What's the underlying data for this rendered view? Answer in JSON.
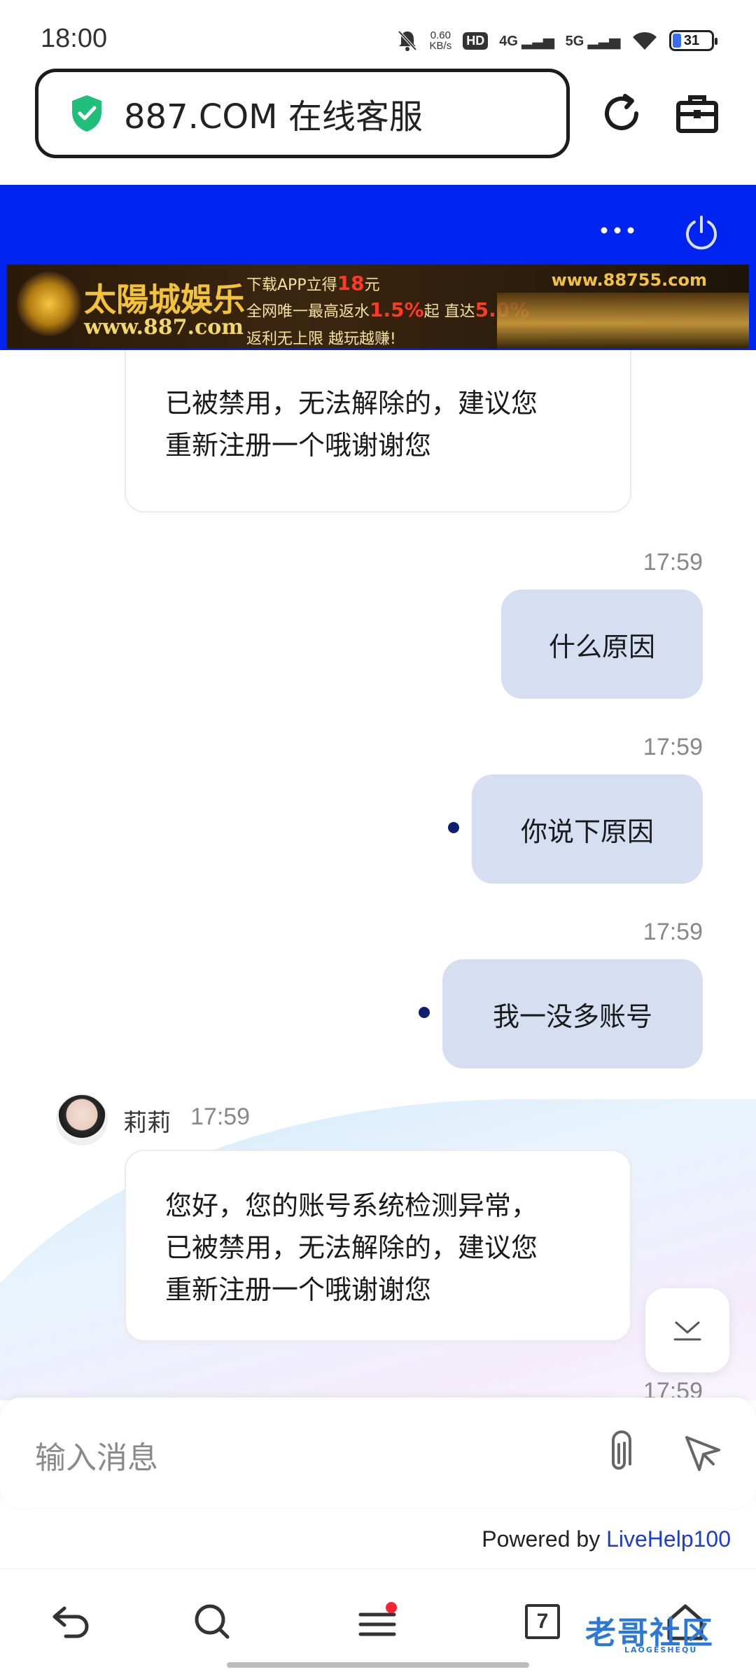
{
  "status_bar": {
    "time": "18:00",
    "net_speed": "0.60",
    "net_unit": "KB/s",
    "hd": "HD",
    "sim1": "4G",
    "sim2": "5G",
    "battery": "31"
  },
  "browser": {
    "address": "887.COM 在线客服",
    "refresh_icon": "refresh-icon",
    "toolbox_icon": "toolbox-icon",
    "shield_color": "#1fbf7a"
  },
  "header": {
    "more_icon": "more-icon",
    "power_icon": "power-icon",
    "accent_color": "#0024f0"
  },
  "banner": {
    "logo": "太陽城娛乐",
    "url_left": "www.887.com",
    "line1_prefix": "下载APP立得",
    "line1_highlight": "18",
    "line1_suffix": "元",
    "line2_prefix": "全网唯一最高返水",
    "line2_highlight1": "1.5%",
    "line2_mid": "起 直达",
    "line2_highlight2": "5.0%",
    "line3": "返利无上限 越玩越赚!",
    "url_right": "www.88755.com"
  },
  "messages": [
    {
      "from": "agent",
      "text_line1": "已被禁用，无法解除的，建议您",
      "text_line2": "重新注册一个哦谢谢您"
    },
    {
      "from": "user",
      "time": "17:59",
      "text": "什么原因"
    },
    {
      "from": "user",
      "time": "17:59",
      "text": "你说下原因"
    },
    {
      "from": "user",
      "time": "17:59",
      "text": "我一没多账号"
    },
    {
      "from": "agent",
      "name": "莉莉",
      "time": "17:59",
      "line1": "您好，您的账号系统检测异常，",
      "line2": "已被禁用，无法解除的，建议您",
      "line3": "重新注册一个哦谢谢您"
    },
    {
      "from": "partial",
      "time": "17:59"
    }
  ],
  "input": {
    "placeholder": "输入消息",
    "attach_icon": "paperclip-icon",
    "send_icon": "send-icon"
  },
  "powered_by": {
    "prefix": "Powered by ",
    "link": "LiveHelp100"
  },
  "bottom_nav": {
    "tab_count": "7",
    "watermark": "老哥社区",
    "watermark_sub": "LAOGESHEQU"
  }
}
